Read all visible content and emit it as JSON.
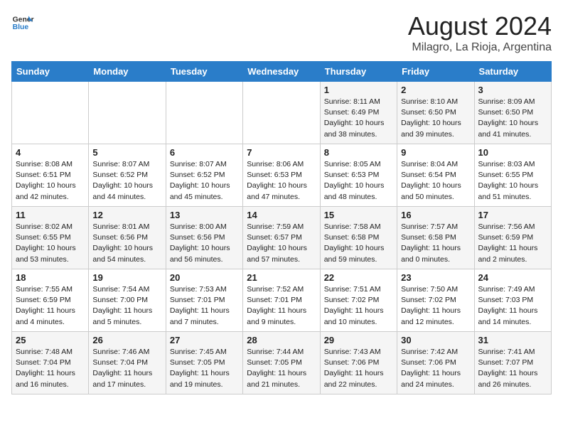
{
  "header": {
    "logo_line1": "General",
    "logo_line2": "Blue",
    "title": "August 2024",
    "subtitle": "Milagro, La Rioja, Argentina"
  },
  "days_of_week": [
    "Sunday",
    "Monday",
    "Tuesday",
    "Wednesday",
    "Thursday",
    "Friday",
    "Saturday"
  ],
  "weeks": [
    [
      {
        "num": "",
        "info": ""
      },
      {
        "num": "",
        "info": ""
      },
      {
        "num": "",
        "info": ""
      },
      {
        "num": "",
        "info": ""
      },
      {
        "num": "1",
        "info": "Sunrise: 8:11 AM\nSunset: 6:49 PM\nDaylight: 10 hours\nand 38 minutes."
      },
      {
        "num": "2",
        "info": "Sunrise: 8:10 AM\nSunset: 6:50 PM\nDaylight: 10 hours\nand 39 minutes."
      },
      {
        "num": "3",
        "info": "Sunrise: 8:09 AM\nSunset: 6:50 PM\nDaylight: 10 hours\nand 41 minutes."
      }
    ],
    [
      {
        "num": "4",
        "info": "Sunrise: 8:08 AM\nSunset: 6:51 PM\nDaylight: 10 hours\nand 42 minutes."
      },
      {
        "num": "5",
        "info": "Sunrise: 8:07 AM\nSunset: 6:52 PM\nDaylight: 10 hours\nand 44 minutes."
      },
      {
        "num": "6",
        "info": "Sunrise: 8:07 AM\nSunset: 6:52 PM\nDaylight: 10 hours\nand 45 minutes."
      },
      {
        "num": "7",
        "info": "Sunrise: 8:06 AM\nSunset: 6:53 PM\nDaylight: 10 hours\nand 47 minutes."
      },
      {
        "num": "8",
        "info": "Sunrise: 8:05 AM\nSunset: 6:53 PM\nDaylight: 10 hours\nand 48 minutes."
      },
      {
        "num": "9",
        "info": "Sunrise: 8:04 AM\nSunset: 6:54 PM\nDaylight: 10 hours\nand 50 minutes."
      },
      {
        "num": "10",
        "info": "Sunrise: 8:03 AM\nSunset: 6:55 PM\nDaylight: 10 hours\nand 51 minutes."
      }
    ],
    [
      {
        "num": "11",
        "info": "Sunrise: 8:02 AM\nSunset: 6:55 PM\nDaylight: 10 hours\nand 53 minutes."
      },
      {
        "num": "12",
        "info": "Sunrise: 8:01 AM\nSunset: 6:56 PM\nDaylight: 10 hours\nand 54 minutes."
      },
      {
        "num": "13",
        "info": "Sunrise: 8:00 AM\nSunset: 6:56 PM\nDaylight: 10 hours\nand 56 minutes."
      },
      {
        "num": "14",
        "info": "Sunrise: 7:59 AM\nSunset: 6:57 PM\nDaylight: 10 hours\nand 57 minutes."
      },
      {
        "num": "15",
        "info": "Sunrise: 7:58 AM\nSunset: 6:58 PM\nDaylight: 10 hours\nand 59 minutes."
      },
      {
        "num": "16",
        "info": "Sunrise: 7:57 AM\nSunset: 6:58 PM\nDaylight: 11 hours\nand 0 minutes."
      },
      {
        "num": "17",
        "info": "Sunrise: 7:56 AM\nSunset: 6:59 PM\nDaylight: 11 hours\nand 2 minutes."
      }
    ],
    [
      {
        "num": "18",
        "info": "Sunrise: 7:55 AM\nSunset: 6:59 PM\nDaylight: 11 hours\nand 4 minutes."
      },
      {
        "num": "19",
        "info": "Sunrise: 7:54 AM\nSunset: 7:00 PM\nDaylight: 11 hours\nand 5 minutes."
      },
      {
        "num": "20",
        "info": "Sunrise: 7:53 AM\nSunset: 7:01 PM\nDaylight: 11 hours\nand 7 minutes."
      },
      {
        "num": "21",
        "info": "Sunrise: 7:52 AM\nSunset: 7:01 PM\nDaylight: 11 hours\nand 9 minutes."
      },
      {
        "num": "22",
        "info": "Sunrise: 7:51 AM\nSunset: 7:02 PM\nDaylight: 11 hours\nand 10 minutes."
      },
      {
        "num": "23",
        "info": "Sunrise: 7:50 AM\nSunset: 7:02 PM\nDaylight: 11 hours\nand 12 minutes."
      },
      {
        "num": "24",
        "info": "Sunrise: 7:49 AM\nSunset: 7:03 PM\nDaylight: 11 hours\nand 14 minutes."
      }
    ],
    [
      {
        "num": "25",
        "info": "Sunrise: 7:48 AM\nSunset: 7:04 PM\nDaylight: 11 hours\nand 16 minutes."
      },
      {
        "num": "26",
        "info": "Sunrise: 7:46 AM\nSunset: 7:04 PM\nDaylight: 11 hours\nand 17 minutes."
      },
      {
        "num": "27",
        "info": "Sunrise: 7:45 AM\nSunset: 7:05 PM\nDaylight: 11 hours\nand 19 minutes."
      },
      {
        "num": "28",
        "info": "Sunrise: 7:44 AM\nSunset: 7:05 PM\nDaylight: 11 hours\nand 21 minutes."
      },
      {
        "num": "29",
        "info": "Sunrise: 7:43 AM\nSunset: 7:06 PM\nDaylight: 11 hours\nand 22 minutes."
      },
      {
        "num": "30",
        "info": "Sunrise: 7:42 AM\nSunset: 7:06 PM\nDaylight: 11 hours\nand 24 minutes."
      },
      {
        "num": "31",
        "info": "Sunrise: 7:41 AM\nSunset: 7:07 PM\nDaylight: 11 hours\nand 26 minutes."
      }
    ]
  ]
}
